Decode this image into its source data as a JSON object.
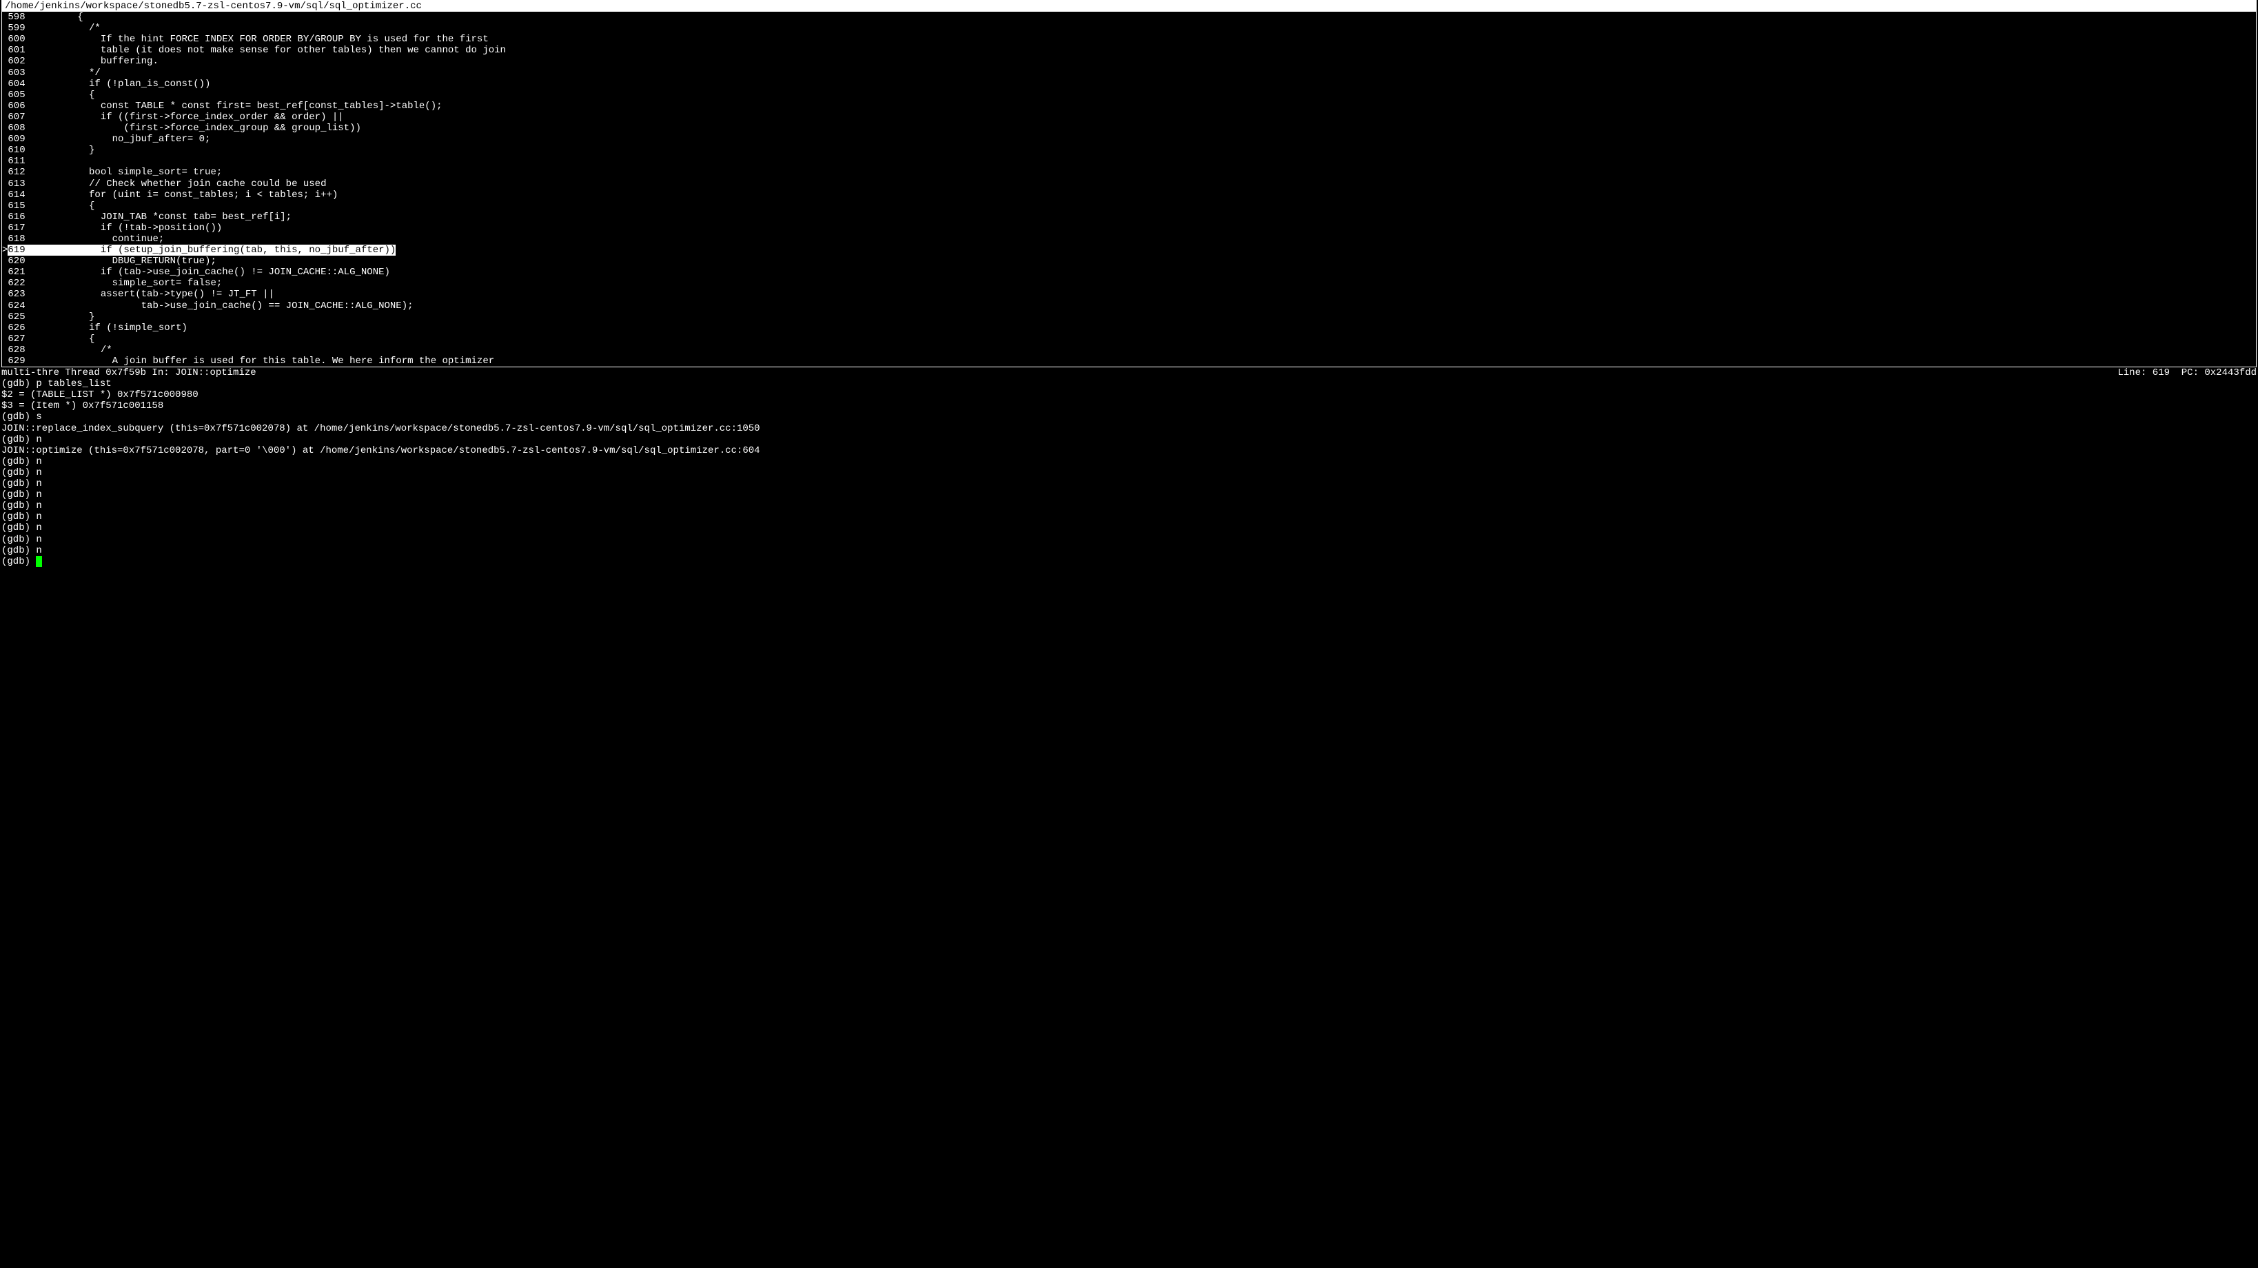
{
  "source": {
    "file_path": "/home/jenkins/workspace/stonedb5.7-zsl-centos7.9-vm/sql/sql_optimizer.cc",
    "current_line_number": 619,
    "lines": [
      {
        "num": "598",
        "text": "         {",
        "current": false
      },
      {
        "num": "599",
        "text": "           /*",
        "current": false
      },
      {
        "num": "600",
        "text": "             If the hint FORCE INDEX FOR ORDER BY/GROUP BY is used for the first",
        "current": false
      },
      {
        "num": "601",
        "text": "             table (it does not make sense for other tables) then we cannot do join",
        "current": false
      },
      {
        "num": "602",
        "text": "             buffering.",
        "current": false
      },
      {
        "num": "603",
        "text": "           */",
        "current": false
      },
      {
        "num": "604",
        "text": "           if (!plan_is_const())",
        "current": false
      },
      {
        "num": "605",
        "text": "           {",
        "current": false
      },
      {
        "num": "606",
        "text": "             const TABLE * const first= best_ref[const_tables]->table();",
        "current": false
      },
      {
        "num": "607",
        "text": "             if ((first->force_index_order && order) ||",
        "current": false
      },
      {
        "num": "608",
        "text": "                 (first->force_index_group && group_list))",
        "current": false
      },
      {
        "num": "609",
        "text": "               no_jbuf_after= 0;",
        "current": false
      },
      {
        "num": "610",
        "text": "           }",
        "current": false
      },
      {
        "num": "611",
        "text": "",
        "current": false
      },
      {
        "num": "612",
        "text": "           bool simple_sort= true;",
        "current": false
      },
      {
        "num": "613",
        "text": "           // Check whether join cache could be used",
        "current": false
      },
      {
        "num": "614",
        "text": "           for (uint i= const_tables; i < tables; i++)",
        "current": false
      },
      {
        "num": "615",
        "text": "           {",
        "current": false
      },
      {
        "num": "616",
        "text": "             JOIN_TAB *const tab= best_ref[i];",
        "current": false
      },
      {
        "num": "617",
        "text": "             if (!tab->position())",
        "current": false
      },
      {
        "num": "618",
        "text": "               continue;",
        "current": false
      },
      {
        "num": "619",
        "text": "             if (setup_join_buffering(tab, this, no_jbuf_after))",
        "current": true
      },
      {
        "num": "620",
        "text": "               DBUG_RETURN(true);",
        "current": false
      },
      {
        "num": "621",
        "text": "             if (tab->use_join_cache() != JOIN_CACHE::ALG_NONE)",
        "current": false
      },
      {
        "num": "622",
        "text": "               simple_sort= false;",
        "current": false
      },
      {
        "num": "623",
        "text": "             assert(tab->type() != JT_FT ||",
        "current": false
      },
      {
        "num": "624",
        "text": "                    tab->use_join_cache() == JOIN_CACHE::ALG_NONE);",
        "current": false
      },
      {
        "num": "625",
        "text": "           }",
        "current": false
      },
      {
        "num": "626",
        "text": "           if (!simple_sort)",
        "current": false
      },
      {
        "num": "627",
        "text": "           {",
        "current": false
      },
      {
        "num": "628",
        "text": "             /*",
        "current": false
      },
      {
        "num": "629",
        "text": "               A join buffer is used for this table. We here inform the optimizer",
        "current": false
      }
    ]
  },
  "status": {
    "left": "multi-thre Thread 0x7f59b In: JOIN::optimize",
    "right": "Line: 619  PC: 0x2443fdd"
  },
  "console": {
    "lines": [
      "(gdb) p tables_list",
      "$2 = (TABLE_LIST *) 0x7f571c000980",
      "$3 = (Item *) 0x7f571c001158",
      "(gdb) s",
      "JOIN::replace_index_subquery (this=0x7f571c002078) at /home/jenkins/workspace/stonedb5.7-zsl-centos7.9-vm/sql/sql_optimizer.cc:1050",
      "(gdb) n",
      "JOIN::optimize (this=0x7f571c002078, part=0 '\\000') at /home/jenkins/workspace/stonedb5.7-zsl-centos7.9-vm/sql/sql_optimizer.cc:604",
      "(gdb) n",
      "(gdb) n",
      "(gdb) n",
      "(gdb) n",
      "(gdb) n",
      "(gdb) n",
      "(gdb) n",
      "(gdb) n",
      "(gdb) n"
    ],
    "prompt": "(gdb) "
  }
}
